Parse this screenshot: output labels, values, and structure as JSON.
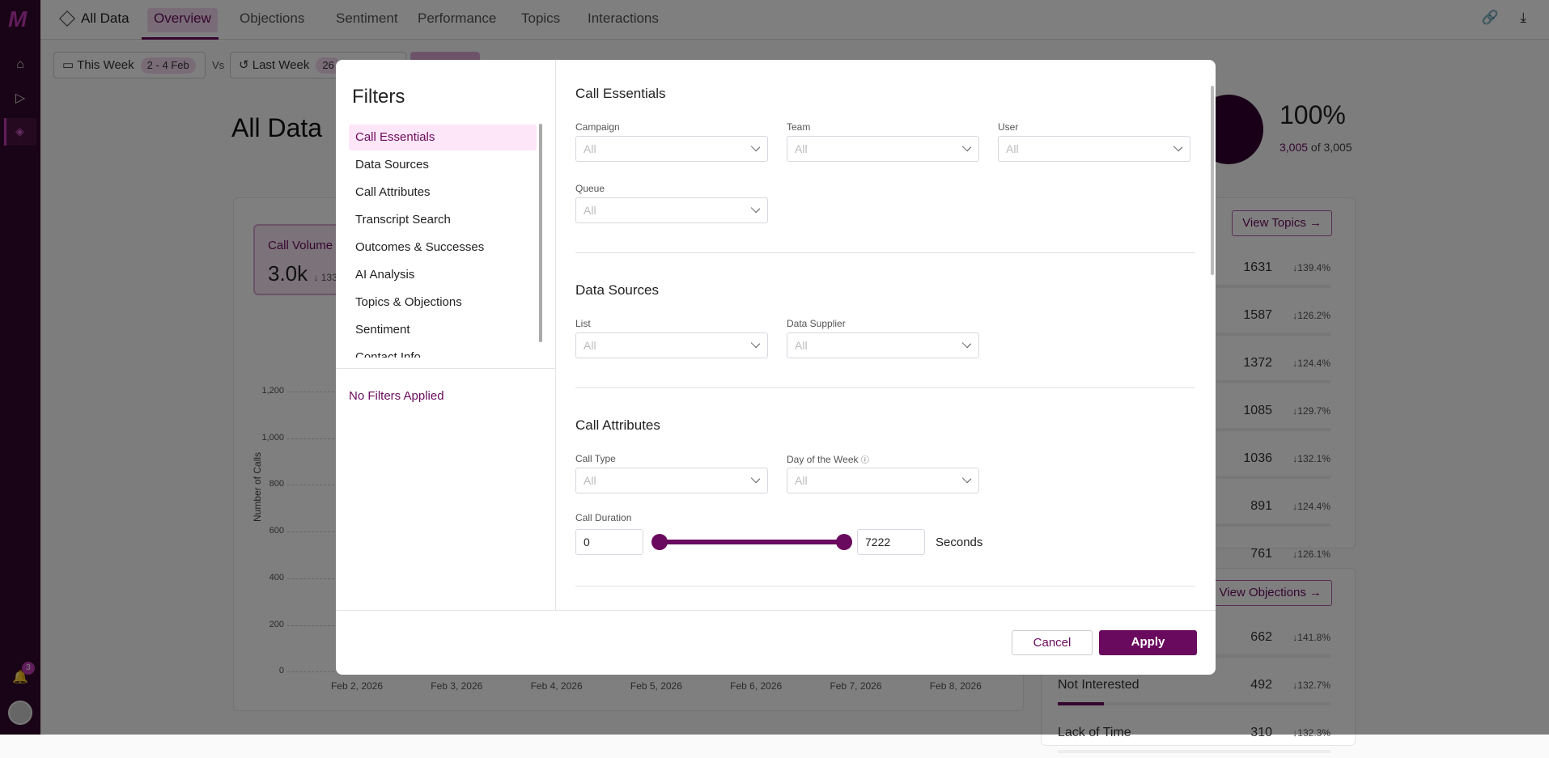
{
  "topbar": {
    "breadcrumb": "All Data",
    "tabs": [
      "Overview",
      "Objections",
      "Sentiment",
      "Performance",
      "Topics",
      "Interactions"
    ]
  },
  "sidebar": {
    "logo": "M",
    "notification_count": "3"
  },
  "date": {
    "current_label": "This Week",
    "current_range": "2 - 4 Feb",
    "vs": "Vs",
    "compare_label": "Last Week",
    "compare_range": "26"
  },
  "page": {
    "title": "All Data",
    "percent": "100%",
    "count_part": "3,005",
    "count_total": " of 3,005"
  },
  "call_volume": {
    "label": "Call Volume",
    "value": "3.0k",
    "change": "↓ 133"
  },
  "chart_data": {
    "type": "line",
    "ylabel": "Number of Calls",
    "ylim": [
      0,
      1200
    ],
    "yticks": [
      "1,200",
      "1,000",
      "800",
      "600",
      "400",
      "200",
      "0"
    ],
    "categories": [
      "Feb 2, 2026",
      "Feb 3, 2026",
      "Feb 4, 2026",
      "Feb 5, 2026",
      "Feb 6, 2026",
      "Feb 7, 2026",
      "Feb 8, 2026"
    ]
  },
  "topics": {
    "button": "View Topics",
    "rows": [
      {
        "value": "1631",
        "change": "139.4%"
      },
      {
        "value": "1587",
        "change": "126.2%"
      },
      {
        "value": "1372",
        "change": "124.4%"
      },
      {
        "value": "1085",
        "change": "129.7%"
      },
      {
        "value": "1036",
        "change": "132.1%"
      },
      {
        "value": "891",
        "change": "124.4%"
      },
      {
        "value": "761",
        "change": "126.1%"
      }
    ]
  },
  "objections": {
    "button": "View Objections",
    "rows": [
      {
        "label": "",
        "value": "662",
        "change": "141.8%"
      },
      {
        "label": "Not Interested",
        "value": "492",
        "change": "132.7%"
      },
      {
        "label": "Lack of Time",
        "value": "310",
        "change": "132.3%"
      }
    ]
  },
  "modal": {
    "title": "Filters",
    "nav": [
      "Call Essentials",
      "Data Sources",
      "Call Attributes",
      "Transcript Search",
      "Outcomes & Successes",
      "AI Analysis",
      "Topics & Objections",
      "Sentiment",
      "Contact Info"
    ],
    "status": "No Filters Applied",
    "sections": {
      "essentials": {
        "title": "Call Essentials",
        "campaign": "Campaign",
        "team": "Team",
        "user": "User",
        "queue": "Queue"
      },
      "sources": {
        "title": "Data Sources",
        "list": "List",
        "supplier": "Data Supplier"
      },
      "attributes": {
        "title": "Call Attributes",
        "call_type": "Call Type",
        "day": "Day of the Week",
        "duration": "Call Duration",
        "min": "0",
        "max": "7222",
        "unit": "Seconds"
      }
    },
    "placeholder": "All",
    "cancel": "Cancel",
    "apply": "Apply"
  }
}
